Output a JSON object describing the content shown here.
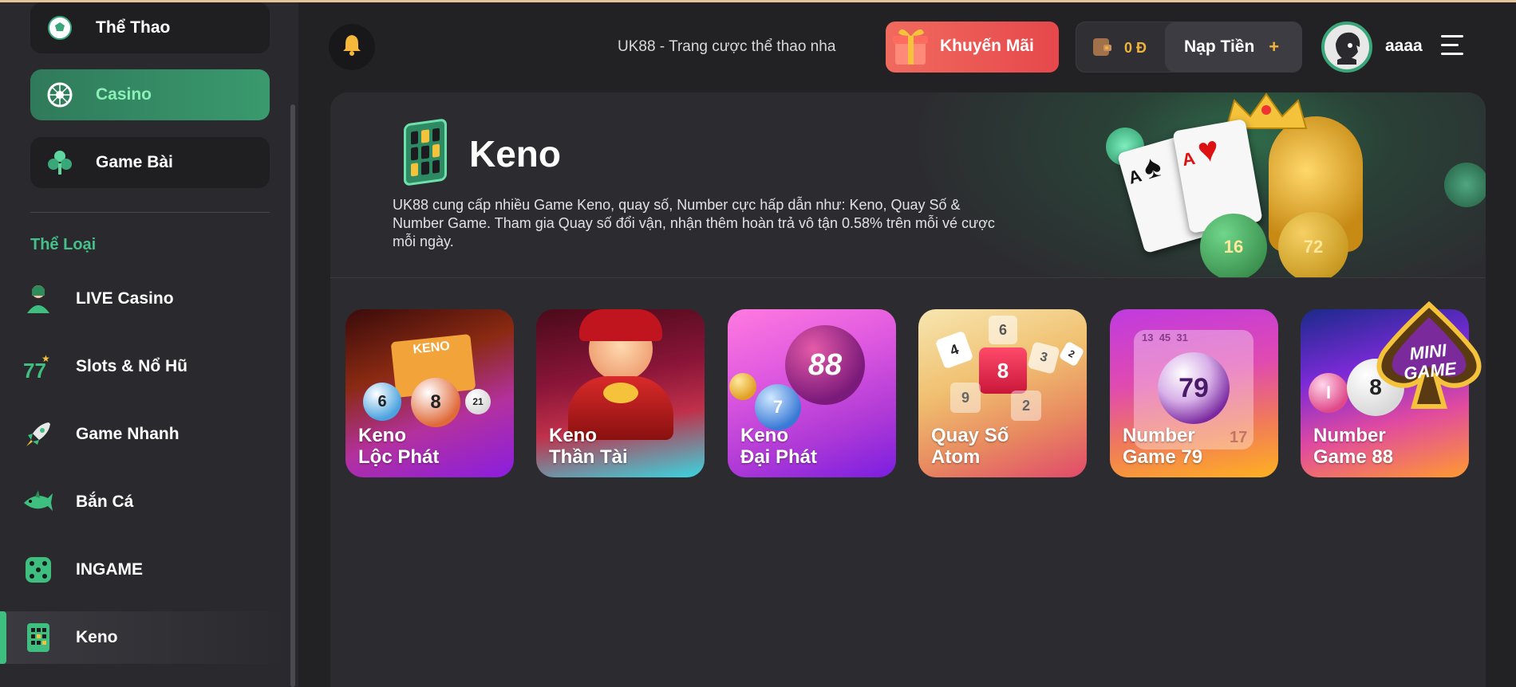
{
  "header": {
    "marquee": "UK88 - Trang cược thể thao nha",
    "promo_label": "Khuyến Mãi",
    "balance": "0 Đ",
    "deposit_label": "Nạp Tiền",
    "deposit_plus": "+",
    "username": "aaaa"
  },
  "sidebar": {
    "top_categories": [
      {
        "label": "Thể Thao",
        "icon": "soccer-ball-icon"
      },
      {
        "label": "Casino",
        "icon": "roulette-icon",
        "active": true
      },
      {
        "label": "Game Bài",
        "icon": "club-card-icon"
      }
    ],
    "section_title": "Thể Loại",
    "items": [
      {
        "label": "LIVE Casino",
        "icon": "live-dealer-icon"
      },
      {
        "label": "Slots & Nổ Hũ",
        "icon": "slot-777-icon"
      },
      {
        "label": "Game Nhanh",
        "icon": "rocket-icon"
      },
      {
        "label": "Bắn Cá",
        "icon": "shark-icon"
      },
      {
        "label": "INGAME",
        "icon": "dice-icon"
      },
      {
        "label": "Keno",
        "icon": "keno-ticket-icon",
        "active": true
      }
    ]
  },
  "hero": {
    "title": "Keno",
    "description": "UK88 cung cấp nhiều Game Keno, quay số, Number cực hấp dẫn như: Keno, Quay Số & Number Game. Tham gia Quay số đổi vận, nhận thêm hoàn trả vô tận 0.58% trên mỗi vé cược mỗi ngày."
  },
  "games": [
    {
      "line1": "Keno",
      "line2": "Lộc Phát",
      "art_numbers": [
        "KENO",
        "6",
        "8",
        "21"
      ]
    },
    {
      "line1": "Keno",
      "line2": "Thần Tài",
      "art_numbers": []
    },
    {
      "line1": "Keno",
      "line2": "Đại Phát",
      "art_numbers": [
        "88",
        "7"
      ]
    },
    {
      "line1": "Quay Số",
      "line2": "Atom",
      "art_numbers": [
        "6",
        "4",
        "8",
        "3",
        "2",
        "9",
        "2"
      ]
    },
    {
      "line1": "Number",
      "line2": "Game 79",
      "art_numbers": [
        "13",
        "45",
        "31",
        "79",
        "17"
      ]
    },
    {
      "line1": "Number",
      "line2": "Game 88",
      "art_numbers": [
        "I",
        "8"
      ]
    }
  ],
  "mini_game": {
    "line1": "MINI",
    "line2": "GAME"
  },
  "hero_art_numbers": [
    "A",
    "A",
    "16",
    "72"
  ],
  "colors": {
    "accent_green": "#3fbf7f",
    "promo_red": "#e6484b",
    "gold": "#f0b43b",
    "background": "#222225"
  }
}
